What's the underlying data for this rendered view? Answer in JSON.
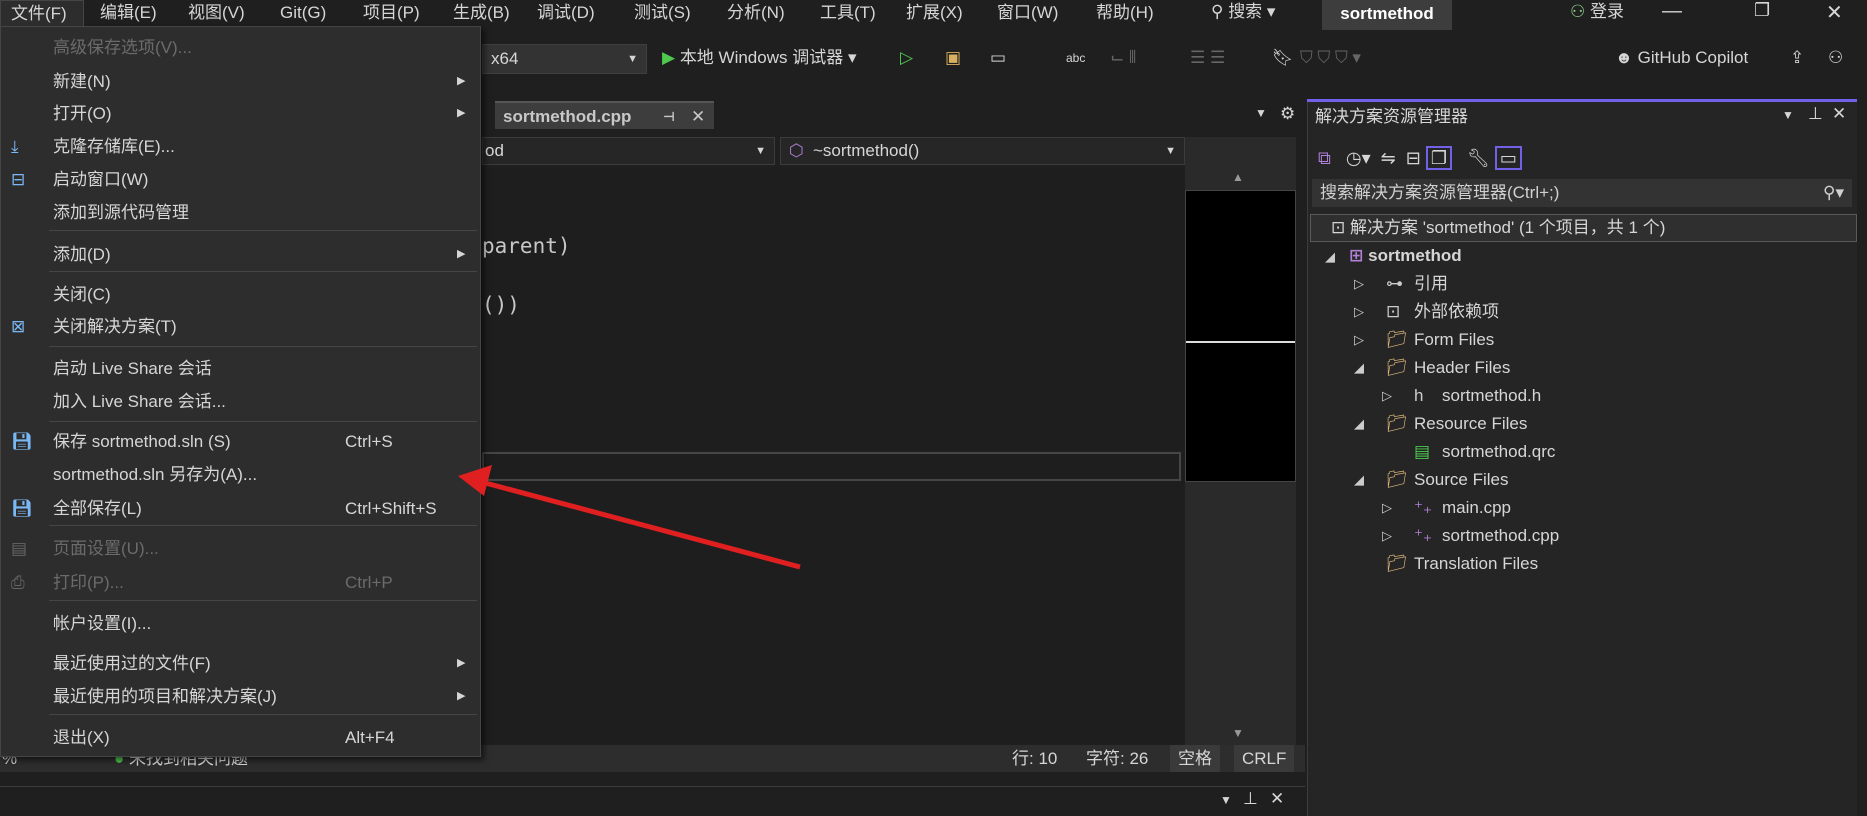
{
  "menubar": {
    "items": [
      "文件(F)",
      "编辑(E)",
      "视图(V)",
      "Git(G)",
      "项目(P)",
      "生成(B)",
      "调试(D)",
      "测试(S)",
      "分析(N)",
      "工具(T)",
      "扩展(X)",
      "窗口(W)",
      "帮助(H)"
    ],
    "search": "搜索",
    "solution_name": "sortmethod",
    "login": "登录"
  },
  "toolbar": {
    "platform": "x64",
    "debugger": "本地 Windows 调试器",
    "copilot": "GitHub Copilot"
  },
  "editor": {
    "tab": "sortmethod.cpp",
    "nav_left": "od",
    "nav_right": "~sortmethod()",
    "code_lines": [
      "parent)",
      "())"
    ]
  },
  "status": {
    "zoom": "%",
    "issues": "未找到相关问题",
    "line": "行: 10",
    "char": "字符: 26",
    "spaces": "空格",
    "eol": "CRLF"
  },
  "solution_explorer": {
    "title": "解决方案资源管理器",
    "search_placeholder": "搜索解决方案资源管理器(Ctrl+;)",
    "root": "解决方案 'sortmethod' (1 个项目，共 1 个)",
    "project": "sortmethod",
    "nodes": [
      "引用",
      "外部依赖项",
      "Form Files",
      "Header Files",
      "sortmethod.h",
      "Resource Files",
      "sortmethod.qrc",
      "Source Files",
      "main.cpp",
      "sortmethod.cpp",
      "Translation Files"
    ]
  },
  "file_menu": {
    "items": [
      {
        "label": "高级保存选项(V)...",
        "disabled": true
      },
      {
        "label": "新建(N)",
        "submenu": true
      },
      {
        "label": "打开(O)",
        "submenu": true
      },
      {
        "label": "克隆存储库(E)...",
        "icon": "clone-icon"
      },
      {
        "label": "启动窗口(W)",
        "icon": "start-window-icon"
      },
      {
        "label": "添加到源代码管理"
      },
      {
        "label": "添加(D)",
        "submenu": true
      },
      {
        "label": "关闭(C)"
      },
      {
        "label": "关闭解决方案(T)",
        "icon": "close-solution-icon"
      },
      {
        "label": "启动 Live Share 会话"
      },
      {
        "label": "加入 Live Share 会话..."
      },
      {
        "label": "保存 sortmethod.sln (S)",
        "shortcut": "Ctrl+S",
        "icon": "save-icon"
      },
      {
        "label": "sortmethod.sln 另存为(A)..."
      },
      {
        "label": "全部保存(L)",
        "shortcut": "Ctrl+Shift+S",
        "icon": "save-all-icon"
      },
      {
        "label": "页面设置(U)...",
        "disabled": true,
        "icon": "page-setup-icon"
      },
      {
        "label": "打印(P)...",
        "shortcut": "Ctrl+P",
        "disabled": true,
        "icon": "print-icon"
      },
      {
        "label": "帐户设置(I)..."
      },
      {
        "label": "最近使用过的文件(F)",
        "submenu": true
      },
      {
        "label": "最近使用的项目和解决方案(J)",
        "submenu": true
      },
      {
        "label": "退出(X)",
        "shortcut": "Alt+F4"
      }
    ]
  },
  "colors": {
    "accent": "#7160e8",
    "arrow": "#e02020",
    "run": "#4ec94e"
  }
}
